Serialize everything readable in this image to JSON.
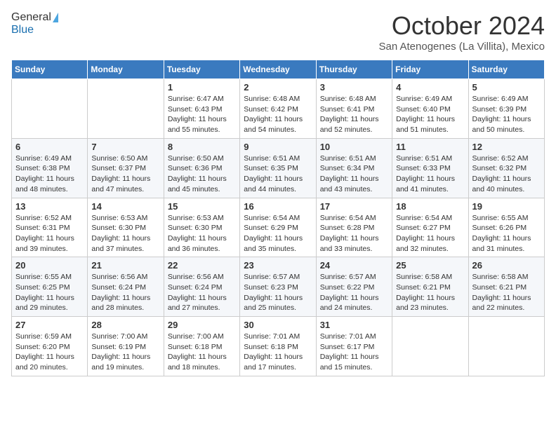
{
  "logo": {
    "general": "General",
    "blue": "Blue"
  },
  "header": {
    "month": "October 2024",
    "location": "San Atenogenes (La Villita), Mexico"
  },
  "weekdays": [
    "Sunday",
    "Monday",
    "Tuesday",
    "Wednesday",
    "Thursday",
    "Friday",
    "Saturday"
  ],
  "weeks": [
    [
      {
        "day": "",
        "text": ""
      },
      {
        "day": "",
        "text": ""
      },
      {
        "day": "1",
        "text": "Sunrise: 6:47 AM\nSunset: 6:43 PM\nDaylight: 11 hours and 55 minutes."
      },
      {
        "day": "2",
        "text": "Sunrise: 6:48 AM\nSunset: 6:42 PM\nDaylight: 11 hours and 54 minutes."
      },
      {
        "day": "3",
        "text": "Sunrise: 6:48 AM\nSunset: 6:41 PM\nDaylight: 11 hours and 52 minutes."
      },
      {
        "day": "4",
        "text": "Sunrise: 6:49 AM\nSunset: 6:40 PM\nDaylight: 11 hours and 51 minutes."
      },
      {
        "day": "5",
        "text": "Sunrise: 6:49 AM\nSunset: 6:39 PM\nDaylight: 11 hours and 50 minutes."
      }
    ],
    [
      {
        "day": "6",
        "text": "Sunrise: 6:49 AM\nSunset: 6:38 PM\nDaylight: 11 hours and 48 minutes."
      },
      {
        "day": "7",
        "text": "Sunrise: 6:50 AM\nSunset: 6:37 PM\nDaylight: 11 hours and 47 minutes."
      },
      {
        "day": "8",
        "text": "Sunrise: 6:50 AM\nSunset: 6:36 PM\nDaylight: 11 hours and 45 minutes."
      },
      {
        "day": "9",
        "text": "Sunrise: 6:51 AM\nSunset: 6:35 PM\nDaylight: 11 hours and 44 minutes."
      },
      {
        "day": "10",
        "text": "Sunrise: 6:51 AM\nSunset: 6:34 PM\nDaylight: 11 hours and 43 minutes."
      },
      {
        "day": "11",
        "text": "Sunrise: 6:51 AM\nSunset: 6:33 PM\nDaylight: 11 hours and 41 minutes."
      },
      {
        "day": "12",
        "text": "Sunrise: 6:52 AM\nSunset: 6:32 PM\nDaylight: 11 hours and 40 minutes."
      }
    ],
    [
      {
        "day": "13",
        "text": "Sunrise: 6:52 AM\nSunset: 6:31 PM\nDaylight: 11 hours and 39 minutes."
      },
      {
        "day": "14",
        "text": "Sunrise: 6:53 AM\nSunset: 6:30 PM\nDaylight: 11 hours and 37 minutes."
      },
      {
        "day": "15",
        "text": "Sunrise: 6:53 AM\nSunset: 6:30 PM\nDaylight: 11 hours and 36 minutes."
      },
      {
        "day": "16",
        "text": "Sunrise: 6:54 AM\nSunset: 6:29 PM\nDaylight: 11 hours and 35 minutes."
      },
      {
        "day": "17",
        "text": "Sunrise: 6:54 AM\nSunset: 6:28 PM\nDaylight: 11 hours and 33 minutes."
      },
      {
        "day": "18",
        "text": "Sunrise: 6:54 AM\nSunset: 6:27 PM\nDaylight: 11 hours and 32 minutes."
      },
      {
        "day": "19",
        "text": "Sunrise: 6:55 AM\nSunset: 6:26 PM\nDaylight: 11 hours and 31 minutes."
      }
    ],
    [
      {
        "day": "20",
        "text": "Sunrise: 6:55 AM\nSunset: 6:25 PM\nDaylight: 11 hours and 29 minutes."
      },
      {
        "day": "21",
        "text": "Sunrise: 6:56 AM\nSunset: 6:24 PM\nDaylight: 11 hours and 28 minutes."
      },
      {
        "day": "22",
        "text": "Sunrise: 6:56 AM\nSunset: 6:24 PM\nDaylight: 11 hours and 27 minutes."
      },
      {
        "day": "23",
        "text": "Sunrise: 6:57 AM\nSunset: 6:23 PM\nDaylight: 11 hours and 25 minutes."
      },
      {
        "day": "24",
        "text": "Sunrise: 6:57 AM\nSunset: 6:22 PM\nDaylight: 11 hours and 24 minutes."
      },
      {
        "day": "25",
        "text": "Sunrise: 6:58 AM\nSunset: 6:21 PM\nDaylight: 11 hours and 23 minutes."
      },
      {
        "day": "26",
        "text": "Sunrise: 6:58 AM\nSunset: 6:21 PM\nDaylight: 11 hours and 22 minutes."
      }
    ],
    [
      {
        "day": "27",
        "text": "Sunrise: 6:59 AM\nSunset: 6:20 PM\nDaylight: 11 hours and 20 minutes."
      },
      {
        "day": "28",
        "text": "Sunrise: 7:00 AM\nSunset: 6:19 PM\nDaylight: 11 hours and 19 minutes."
      },
      {
        "day": "29",
        "text": "Sunrise: 7:00 AM\nSunset: 6:18 PM\nDaylight: 11 hours and 18 minutes."
      },
      {
        "day": "30",
        "text": "Sunrise: 7:01 AM\nSunset: 6:18 PM\nDaylight: 11 hours and 17 minutes."
      },
      {
        "day": "31",
        "text": "Sunrise: 7:01 AM\nSunset: 6:17 PM\nDaylight: 11 hours and 15 minutes."
      },
      {
        "day": "",
        "text": ""
      },
      {
        "day": "",
        "text": ""
      }
    ]
  ]
}
